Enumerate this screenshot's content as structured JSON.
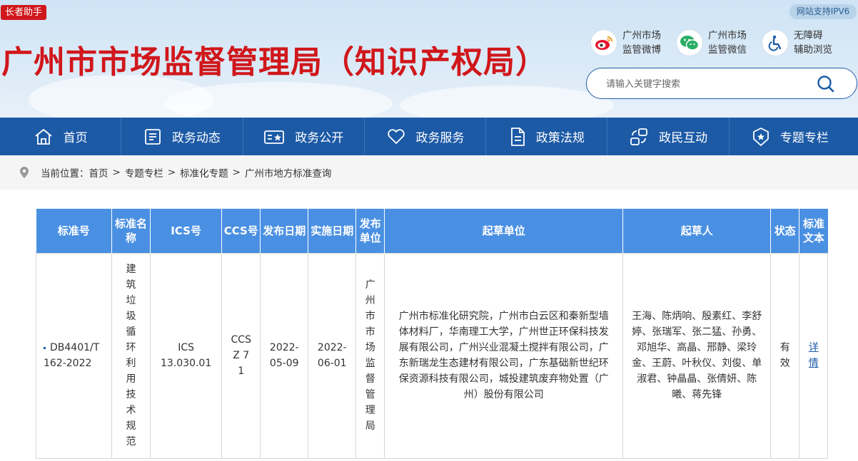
{
  "header": {
    "elder_assistant": "长者助手",
    "ipv6": "网站支持IPV6",
    "site_title": "广州市市场监督管理局（知识产权局）",
    "quick_links": [
      {
        "icon": "weibo-icon",
        "line1": "广州市场",
        "line2": "监管微博"
      },
      {
        "icon": "wechat-icon",
        "line1": "广州市场",
        "line2": "监管微信"
      },
      {
        "icon": "accessibility-icon",
        "line1": "无障碍",
        "line2": "辅助浏览"
      }
    ],
    "search": {
      "placeholder": "请输入关键字搜索"
    }
  },
  "nav": [
    {
      "label": "首页",
      "icon": "home-icon"
    },
    {
      "label": "政务动态",
      "icon": "news-icon"
    },
    {
      "label": "政务公开",
      "icon": "disclosure-icon"
    },
    {
      "label": "政务服务",
      "icon": "heart-icon"
    },
    {
      "label": "政策法规",
      "icon": "document-icon"
    },
    {
      "label": "政民互动",
      "icon": "interaction-icon"
    },
    {
      "label": "专题专栏",
      "icon": "badge-icon"
    }
  ],
  "breadcrumb": {
    "prefix": "当前位置：",
    "items": [
      "首页",
      "专题专栏",
      "标准化专题",
      "广州市地方标准查询"
    ],
    "separator": ">"
  },
  "table": {
    "headers": [
      "标准号",
      "标准名称",
      "ICS号",
      "CCS号",
      "发布日期",
      "实施日期",
      "发布单位",
      "起草单位",
      "起草人",
      "状态",
      "标准文本"
    ],
    "rows": [
      {
        "standard_no": "DB4401/T 162-2022",
        "standard_name": "建筑垃圾循环利用技术规范",
        "ics": "ICS 13.030.01",
        "ccs": "CCS Z 71",
        "publish_date": "2022-05-09",
        "implement_date": "2022-06-01",
        "publisher": "广州市市场监督管理局",
        "drafting_units": "广州市标准化研究院，广州市白云区和秦新型墙体材料厂，华南理工大学，广州世正环保科技发展有限公司，广州兴业混凝土搅拌有限公司，广东新瑞龙生态建材有限公司，广东基础新世纪环保资源科技有限公司，城投建筑废弃物处置（广州）股份有限公司",
        "drafters": "王海、陈炳响、殷素红、李舒婷、张瑞军、张二猛、孙勇、邓旭华、高晶、邢静、梁玲金、王蔚、叶秋仪、刘俊、单淑君、钟晶晶、张倩妍、陈曦、蒋先锋",
        "status": "有效",
        "text_link": "详情"
      }
    ]
  },
  "colors": {
    "brand_red": "#d0171b",
    "nav_blue": "#1c5aa6",
    "table_header_blue": "#4a90e2"
  }
}
